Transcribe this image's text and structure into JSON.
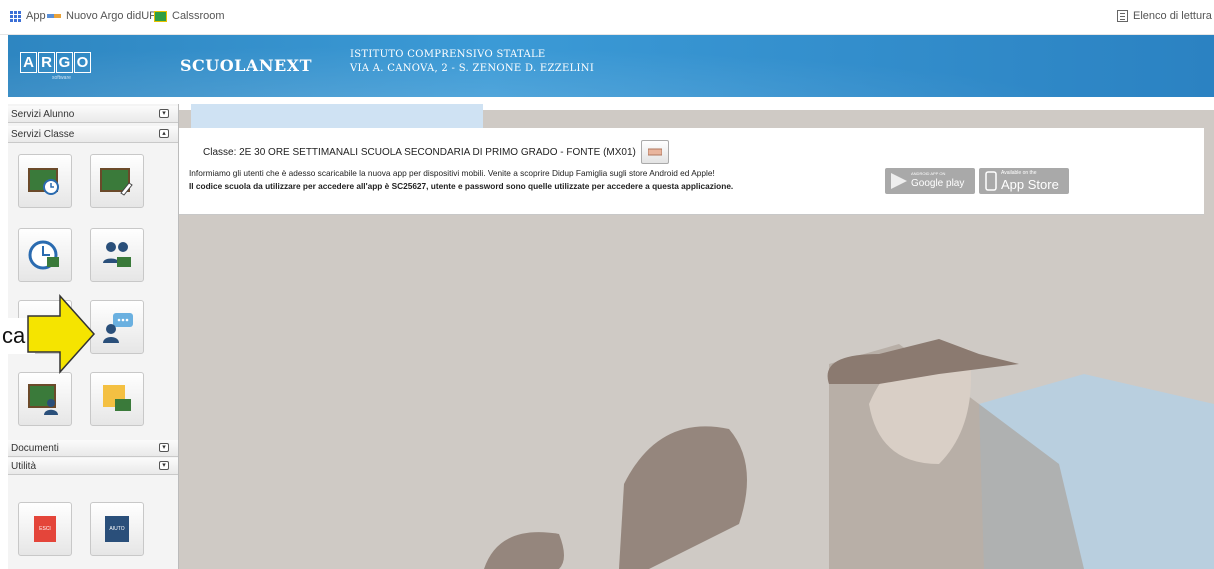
{
  "bookmarks": {
    "apps_label": "App",
    "argo_label": "Nuovo Argo didUP",
    "classroom_label": "Calssroom",
    "reading_list_label": "Elenco di lettura"
  },
  "header": {
    "logo_letters": [
      "A",
      "R",
      "G",
      "O"
    ],
    "logo_sub": "software",
    "product": "SCUOLANEXT",
    "school_line1": "ISTITUTO COMPRENSIVO STATALE",
    "school_line2": "VIA A. CANOVA, 2 - S. ZENONE D. EZZELINI"
  },
  "sidebar": {
    "sections": [
      {
        "label": "Servizi Alunno",
        "toggle": "▾"
      },
      {
        "label": "Servizi Classe",
        "toggle": "▴"
      },
      {
        "label": "Documenti",
        "toggle": "▾"
      },
      {
        "label": "Utilità",
        "toggle": "▾"
      }
    ],
    "utility_buttons": {
      "exit": "ESCI",
      "help": "AIUTO"
    }
  },
  "main": {
    "class_label": "Classe: 2E 30 ORE SETTIMANALI SCUOLA SECONDARIA DI PRIMO GRADO - FONTE (MX01)",
    "notice": "Informiamo gli utenti che è adesso scaricabile la nuova app per dispositivi mobili. Venite a scoprire Didup Famiglia sugli store Android ed Apple!",
    "code_line": "Il codice scuola da utilizzare per accedere all'app è SC25627, utente e password sono quelle utilizzate per accedere a questa applicazione.",
    "google_play": {
      "small": "ANDROID APP ON",
      "big": "Google play"
    },
    "app_store": {
      "small": "Available on the",
      "big": "App Store"
    }
  },
  "callout": {
    "text": "ca"
  },
  "colors": {
    "header_blue": "#2e86c1",
    "background": "#cfcac5",
    "arrow": "#f5e400"
  }
}
